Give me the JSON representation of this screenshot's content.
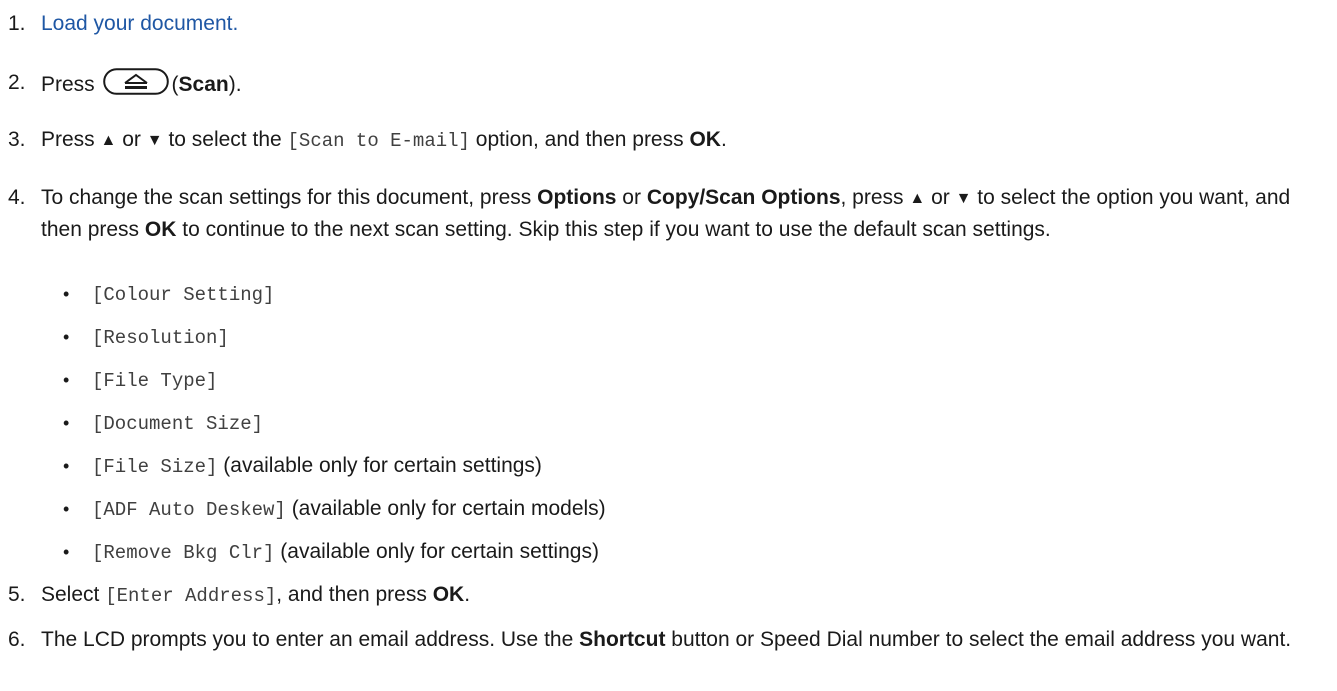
{
  "steps": [
    {
      "num": "1.",
      "link_text": "Load your document."
    },
    {
      "num": "2.",
      "press": "Press",
      "open_paren": "(",
      "bold": "Scan",
      "close": ")."
    },
    {
      "num": "3.",
      "press": "Press",
      "or": "or",
      "to_select": "to select the",
      "option": "[Scan to E-mail]",
      "rest": "option, and then press",
      "bold_ok": "OK",
      "end": "."
    },
    {
      "num": "4.",
      "t1": "To change the scan settings for this document, press",
      "b1": "Options",
      "t2": "or",
      "b2": "Copy/Scan Options",
      "t3": ", press",
      "t4": "or",
      "t5": "to select the option you want, and then press",
      "b3": "OK",
      "t6": "to continue to the next scan setting. Skip this step if you want to use the default scan settings."
    },
    {
      "num": "5.",
      "t1": "Select",
      "option": "[Enter Address]",
      "t2": ", and then press",
      "bold_ok": "OK",
      "end": "."
    },
    {
      "num": "6.",
      "t1": "The LCD prompts you to enter an email address. Use the",
      "b1": "Shortcut",
      "t2": "button or Speed Dial number to select the email address you want."
    }
  ],
  "symbols": {
    "up": "▲",
    "down": "▼",
    "bullet": "•"
  },
  "options": [
    {
      "code": "[Colour Setting]",
      "note": ""
    },
    {
      "code": "[Resolution]",
      "note": ""
    },
    {
      "code": "[File Type]",
      "note": ""
    },
    {
      "code": "[Document Size]",
      "note": ""
    },
    {
      "code": "[File Size]",
      "note": "(available only for certain settings)"
    },
    {
      "code": "[ADF Auto Deskew]",
      "note": "(available only for certain models)"
    },
    {
      "code": "[Remove Bkg Clr]",
      "note": "(available only for certain settings)"
    }
  ],
  "icons": {
    "scan_button": "scan-button-icon"
  },
  "colors": {
    "link": "#1f57a4",
    "text": "#1a1a1a",
    "mono": "#404040"
  }
}
